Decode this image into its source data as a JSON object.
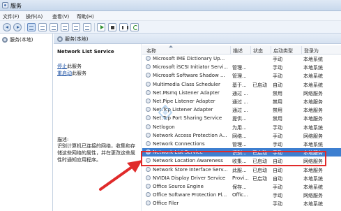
{
  "window": {
    "title": "服务"
  },
  "menu": [
    "文件(F)",
    "操作(A)",
    "查看(V)",
    "帮助(H)"
  ],
  "toolbar": [
    "back-icon",
    "forward-icon",
    "console-tree-icon",
    "view-icon",
    "refresh-icon",
    "export-icon",
    "help-icon",
    "properties-icon",
    "start-icon",
    "stop-icon",
    "pause-icon",
    "restart-icon"
  ],
  "tree": {
    "root_label": "服务(本地)"
  },
  "pane_header": {
    "label": "服务(本地)"
  },
  "details": {
    "service_name": "Network List Service",
    "stop_link": "停止",
    "stop_suffix": "此服务",
    "restart_link": "重启动",
    "restart_suffix": "此服务",
    "desc_label": "描述:",
    "desc_text": "识别计算机已连接的网络，收集和存储这些网络的属性，并在更改这些属性时通知应用程序。"
  },
  "columns": {
    "name": "名称",
    "desc": "描述",
    "status": "状态",
    "startup": "启动类型",
    "logon": "登录为"
  },
  "services": [
    {
      "name": "Microsoft IME Dictionary Up...",
      "desc": "",
      "status": "",
      "startup": "手动",
      "logon": "本地系统"
    },
    {
      "name": "Microsoft iSCSI Initiator Servi...",
      "desc": "管理...",
      "status": "",
      "startup": "手动",
      "logon": "本地系统"
    },
    {
      "name": "Microsoft Software Shadow ...",
      "desc": "管理...",
      "status": "",
      "startup": "手动",
      "logon": "本地系统"
    },
    {
      "name": "Multimedia Class Scheduler",
      "desc": "基于...",
      "status": "已启动",
      "startup": "自动",
      "logon": "本地系统"
    },
    {
      "name": "Net.Msmq Listener Adapter",
      "desc": "通过 ...",
      "status": "",
      "startup": "禁用",
      "logon": "网络服务"
    },
    {
      "name": "Net.Pipe Listener Adapter",
      "desc": "通过 ...",
      "status": "",
      "startup": "禁用",
      "logon": "本地服务"
    },
    {
      "name": "Net.Tcp Listener Adapter",
      "desc": "通过 ...",
      "status": "",
      "startup": "禁用",
      "logon": "本地服务"
    },
    {
      "name": "Net.Tcp Port Sharing Service",
      "desc": "提供...",
      "status": "",
      "startup": "禁用",
      "logon": "本地服务"
    },
    {
      "name": "Netlogon",
      "desc": "为用...",
      "status": "",
      "startup": "手动",
      "logon": "本地系统"
    },
    {
      "name": "Network Access Protection A...",
      "desc": "网络...",
      "status": "",
      "startup": "手动",
      "logon": "网络服务"
    },
    {
      "name": "Network Connections",
      "desc": "管理...",
      "status": "",
      "startup": "手动",
      "logon": "本地系统"
    },
    {
      "name": "Network List Service",
      "desc": "识别...",
      "status": "已启动",
      "startup": "手动",
      "logon": "本地服务"
    },
    {
      "name": "Network Location Awareness",
      "desc": "收集...",
      "status": "已启动",
      "startup": "自动",
      "logon": "网络服务"
    },
    {
      "name": "Network Store Interface Serv...",
      "desc": "此服...",
      "status": "已启动",
      "startup": "自动",
      "logon": "本地服务"
    },
    {
      "name": "NVIDIA Display Driver Service",
      "desc": "Provi...",
      "status": "已启动",
      "startup": "自动",
      "logon": "本地系统"
    },
    {
      "name": "Office  Source Engine",
      "desc": "保存...",
      "status": "",
      "startup": "手动",
      "logon": "本地系统"
    },
    {
      "name": "Office Software Protection Pl...",
      "desc": "Offic...",
      "status": "",
      "startup": "手动",
      "logon": "网络服务"
    },
    {
      "name": "Office Filer",
      "desc": "",
      "status": "",
      "startup": "手动",
      "logon": "本地系统"
    }
  ],
  "selected_service": "Network List Service",
  "colors": {
    "selection": "#3d7fd0",
    "highlight_box": "#e02a2a",
    "link": "#1a4fa3"
  }
}
